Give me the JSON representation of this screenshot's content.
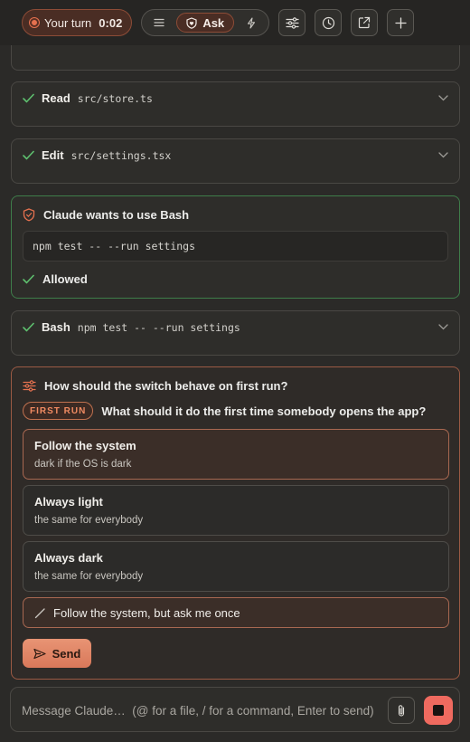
{
  "toolbar": {
    "turn_label": "Your turn",
    "turn_timer": "0:02",
    "mode_active": "Ask",
    "mode_list_icon": "list-icon",
    "mode_auto_icon": "lightning-icon",
    "buttons": [
      "sliders-icon",
      "history-icon",
      "open-external-icon",
      "plus-icon"
    ]
  },
  "feed": {
    "tool_calls": [
      {
        "verb": "Read",
        "arg": "src/store.ts"
      },
      {
        "verb": "Edit",
        "arg": "src/settings.tsx"
      }
    ],
    "permission": {
      "title": "Claude wants to use Bash",
      "command": "npm test -- --run settings",
      "status": "Allowed"
    },
    "bash": {
      "verb": "Bash",
      "arg": "npm test -- --run settings"
    }
  },
  "question": {
    "title": "How should the switch behave on first run?",
    "badge": "FIRST RUN",
    "prompt": "What should it do the first time somebody opens the app?",
    "options": [
      {
        "label": "Follow the system",
        "desc": "dark if the OS is dark",
        "selected": true
      },
      {
        "label": "Always light",
        "desc": "the same for everybody",
        "selected": false
      },
      {
        "label": "Always dark",
        "desc": "the same for everybody",
        "selected": false
      }
    ],
    "custom_answer": "Follow the system, but ask me once",
    "send_label": "Send"
  },
  "composer": {
    "placeholder": "Message Claude…  (@ for a file, / for a command, Enter to send)"
  },
  "colors": {
    "accent": "#e5714f",
    "success": "#5ebf6e",
    "stop": "#ef6a5f"
  }
}
